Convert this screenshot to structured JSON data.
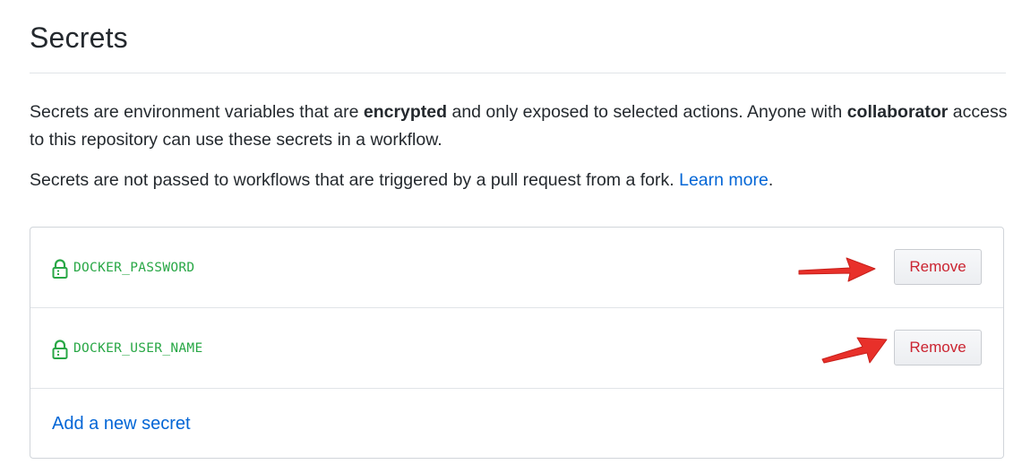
{
  "page": {
    "title": "Secrets"
  },
  "intro": {
    "p1_before_encrypted": "Secrets are environment variables that are ",
    "p1_encrypted": "encrypted",
    "p1_middle": " and only exposed to selected actions. Anyone with ",
    "p1_collaborator": "collaborator",
    "p1_after": " access to this repository can use these secrets in a workflow.",
    "p2_text": "Secrets are not passed to workflows that are triggered by a pull request from a fork. ",
    "p2_link": "Learn more",
    "p2_end": "."
  },
  "secrets": {
    "items": [
      {
        "name": "DOCKER_PASSWORD",
        "remove_label": "Remove"
      },
      {
        "name": "DOCKER_USER_NAME",
        "remove_label": "Remove"
      }
    ],
    "add_label": "Add a new secret"
  },
  "icons": {
    "secret_icon": "lock-icon",
    "annotation": "red-arrow-icon"
  },
  "colors": {
    "secret_name": "#28a745",
    "remove_text": "#cb2431",
    "link": "#0366d6",
    "annotation_arrow": "#e8302a"
  }
}
